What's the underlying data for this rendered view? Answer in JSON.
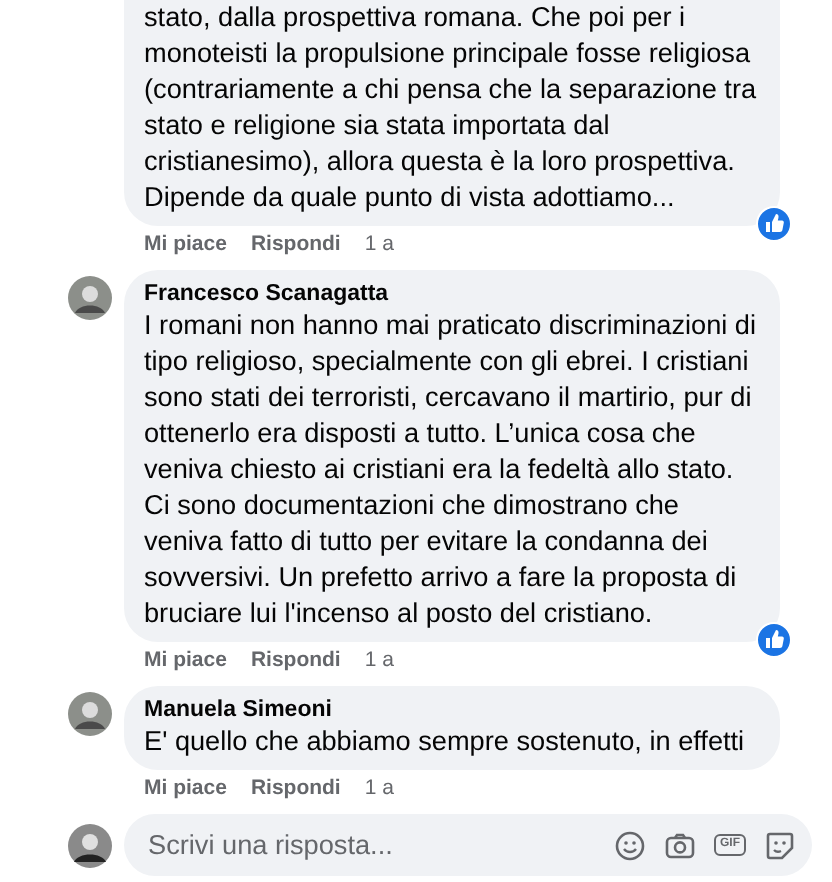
{
  "comments": [
    {
      "text": "stato, dalla prospettiva romana. Che poi per i monoteisti la propulsione principale fosse religiosa (contrariamente a chi pensa che la separazione tra stato e religione sia stata importata dal cristianesimo), allora questa è la loro prospettiva. Dipende da quale punto di vista adottiamo...",
      "liked": true,
      "actions": [
        "Mi piace",
        "Rispondi"
      ],
      "time": "1 a"
    },
    {
      "author": "Francesco Scanagatta",
      "text": "I romani non hanno mai praticato discriminazioni di tipo religioso, specialmente con gli ebrei. I cristiani sono stati dei terroristi, cercavano il martirio, pur di ottenerlo era disposti a tutto. L’unica cosa che veniva chiesto ai cristiani era la fedeltà allo stato. Ci sono documentazioni che dimostrano che veniva fatto di tutto per evitare la condanna dei sovversivi. Un prefetto arrivo a fare la proposta di bruciare lui l'incenso al posto del cristiano.",
      "liked": true,
      "actions": [
        "Mi piace",
        "Rispondi"
      ],
      "time": "1 a",
      "has_avatar": true
    },
    {
      "author": "Manuela Simeoni",
      "text": "E' quello che abbiamo sempre sostenuto, in effetti",
      "liked": false,
      "actions": [
        "Mi piace",
        "Rispondi"
      ],
      "time": "1 a",
      "has_avatar": true
    }
  ],
  "reply": {
    "placeholder": "Scrivi una risposta...",
    "gif_label": "GIF"
  }
}
